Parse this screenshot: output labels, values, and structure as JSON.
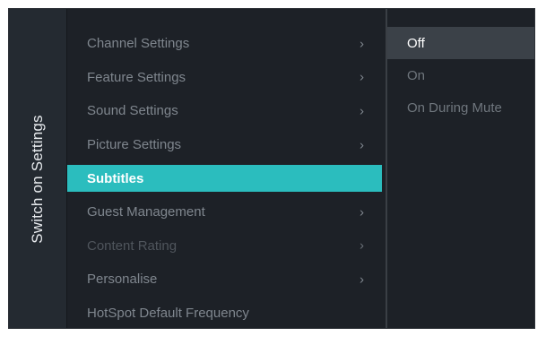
{
  "panel_title": "Switch on Settings",
  "menu": [
    {
      "label": "Channel Settings",
      "chevron": "›",
      "state": "normal"
    },
    {
      "label": "Feature Settings",
      "chevron": "›",
      "state": "normal"
    },
    {
      "label": "Sound Settings",
      "chevron": "›",
      "state": "normal"
    },
    {
      "label": "Picture Settings",
      "chevron": "›",
      "state": "normal"
    },
    {
      "label": "Subtitles",
      "chevron": "",
      "state": "active"
    },
    {
      "label": "Guest Management",
      "chevron": "›",
      "state": "normal"
    },
    {
      "label": "Content Rating",
      "chevron": "›",
      "state": "dim"
    },
    {
      "label": "Personalise",
      "chevron": "›",
      "state": "normal"
    },
    {
      "label": "HotSpot Default Frequency",
      "chevron": "",
      "state": "normal"
    }
  ],
  "options": [
    {
      "label": "Off",
      "selected": true
    },
    {
      "label": "On",
      "selected": false
    },
    {
      "label": "On During Mute",
      "selected": false
    }
  ],
  "colors": {
    "active_highlight": "#2bbdbe",
    "background": "#1d2127",
    "option_selected": "#3b4148"
  },
  "icons": {
    "menu_chevron": "chevron-right-icon"
  }
}
